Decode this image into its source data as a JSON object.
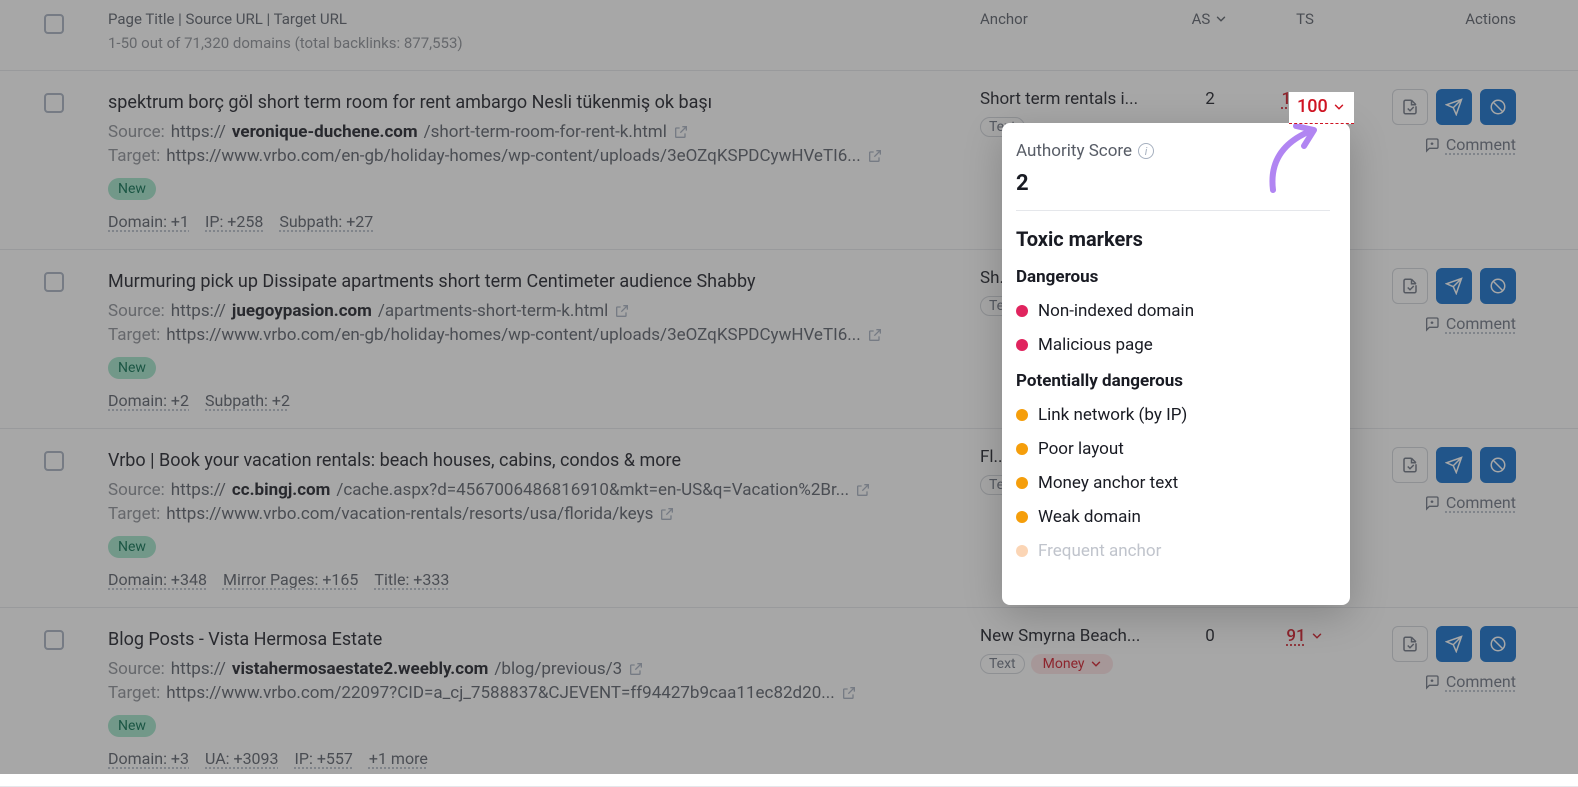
{
  "header": {
    "titleLabel": "Page Title | Source URL | Target URL",
    "subLabel": "1-50 out of 71,320 domains (total backlinks: 877,553)",
    "anchor": "Anchor",
    "as": "AS",
    "ts": "TS",
    "actions": "Actions"
  },
  "labels": {
    "source": "Source:",
    "target": "Target:",
    "comment": "Comment",
    "new": "New",
    "text": "Text",
    "money": "Money"
  },
  "popover": {
    "asLabel": "Authority Score",
    "asVal": "2",
    "toxic": "Toxic markers",
    "dangerous": "Dangerous",
    "dangerItems": [
      "Non-indexed domain",
      "Malicious page"
    ],
    "potDanger": "Potentially dangerous",
    "potItems": [
      "Link network (by IP)",
      "Poor layout",
      "Money anchor text",
      "Weak domain"
    ],
    "fadeItem": "Frequent anchor"
  },
  "tsPill": "100",
  "rows": [
    {
      "title": "spektrum borç göl short term room for rent ambargo Nesli tükenmiş ok başı",
      "srcPrefix": "https://",
      "srcBold": "veronique-duchene.com",
      "srcRest": "/short-term-room-for-rent-k.html",
      "tgt": "https://www.vrbo.com/en-gb/holiday-homes/wp-content/uploads/3eOZqKSPDCywHVeTI6...",
      "anchor": "Short term rentals i...",
      "as": "2",
      "ts": "100",
      "meta": [
        "Domain: +1",
        "IP: +258",
        "Subpath: +27"
      ],
      "showText": true,
      "showMoney": false
    },
    {
      "title": "Murmuring pick up Dissipate apartments short term Centimeter audience Shabby",
      "srcPrefix": "https://",
      "srcBold": "juegoypasion.com",
      "srcRest": "/apartments-short-term-k.html",
      "tgt": "https://www.vrbo.com/en-gb/holiday-homes/wp-content/uploads/3eOZqKSPDCywHVeTI6...",
      "anchor": "Sh...",
      "as": "",
      "ts": "",
      "meta": [
        "Domain: +2",
        "Subpath: +2"
      ],
      "showText": true,
      "showMoney": false
    },
    {
      "title": "Vrbo | Book your vacation rentals: beach houses, cabins, condos & more",
      "srcPrefix": "https://",
      "srcBold": "cc.bingj.com",
      "srcRest": "/cache.aspx?d=4567006486816910&mkt=en-US&q=Vacation%2Br...",
      "tgt": "https://www.vrbo.com/vacation-rentals/resorts/usa/florida/keys",
      "anchor": "Fl...",
      "as": "",
      "ts": "",
      "meta": [
        "Domain: +348",
        "Mirror Pages: +165",
        "Title: +333"
      ],
      "showText": true,
      "showMoney": false
    },
    {
      "title": "Blog Posts - Vista Hermosa Estate",
      "srcPrefix": "https://",
      "srcBold": "vistahermosaestate2.weebly.com",
      "srcRest": "/blog/previous/3",
      "tgt": "https://www.vrbo.com/22097?CID=a_cj_7588837&CJEVENT=ff94427b9caa11ec82d20...",
      "anchor": "New Smyrna Beach...",
      "as": "0",
      "ts": "91",
      "meta": [
        "Domain: +3",
        "UA: +3093",
        "IP: +557",
        "+1 more"
      ],
      "showText": true,
      "showMoney": true
    }
  ]
}
